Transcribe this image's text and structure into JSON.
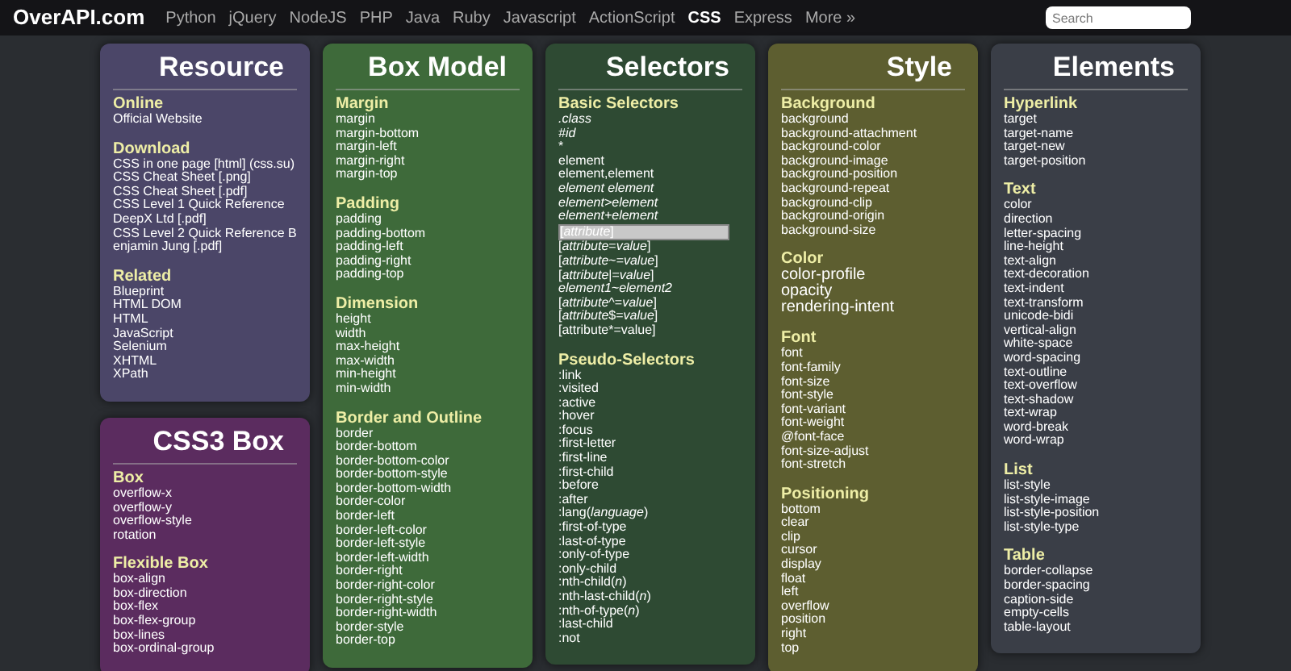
{
  "nav": {
    "logo": "OverAPI.com",
    "links": [
      {
        "label": "Python",
        "selected": false
      },
      {
        "label": "jQuery",
        "selected": false
      },
      {
        "label": "NodeJS",
        "selected": false
      },
      {
        "label": "PHP",
        "selected": false
      },
      {
        "label": "Java",
        "selected": false
      },
      {
        "label": "Ruby",
        "selected": false
      },
      {
        "label": "Javascript",
        "selected": false
      },
      {
        "label": "ActionScript",
        "selected": false
      },
      {
        "label": "CSS",
        "selected": true
      },
      {
        "label": "Express",
        "selected": false
      },
      {
        "label": "More »",
        "selected": false
      }
    ],
    "search": {
      "placeholder": "Search"
    }
  },
  "columns": [
    {
      "cards": [
        {
          "title": "Resource",
          "color": "#4b4668",
          "sections": [
            {
              "heading": "Online",
              "items": [
                "Official Website"
              ]
            },
            {
              "heading": "Download",
              "items": [
                "CSS in one page [html] (css.su)",
                "CSS Cheat Sheet [.png]",
                "CSS Cheat Sheet [.pdf]",
                "CSS Level 1 Quick Reference DeepX Ltd [.pdf]",
                "CSS Level 2 Quick Reference Benjamin Jung [.pdf]"
              ]
            },
            {
              "heading": "Related",
              "items": [
                "Blueprint",
                "HTML DOM",
                "HTML",
                "JavaScript",
                "Selenium",
                "XHTML",
                "XPath"
              ]
            }
          ]
        },
        {
          "title": "CSS3 Box",
          "color": "#5b2c5f",
          "sections": [
            {
              "heading": "Box",
              "items": [
                "overflow-x",
                "overflow-y",
                "overflow-style",
                "rotation"
              ]
            },
            {
              "heading": "Flexible Box",
              "items": [
                "box-align",
                "box-direction",
                "box-flex",
                "box-flex-group",
                "box-lines",
                "box-ordinal-group"
              ]
            }
          ]
        }
      ]
    },
    {
      "cards": [
        {
          "title": "Box Model",
          "color": "#3e6a3a",
          "sections": [
            {
              "heading": "Margin",
              "items": [
                "margin",
                "margin-bottom",
                "margin-left",
                "margin-right",
                "margin-top"
              ]
            },
            {
              "heading": "Padding",
              "items": [
                "padding",
                "padding-bottom",
                "padding-left",
                "padding-right",
                "padding-top"
              ]
            },
            {
              "heading": "Dimension",
              "items": [
                "height",
                "width",
                "max-height",
                "max-width",
                "min-height",
                "min-width"
              ]
            },
            {
              "heading": "Border and Outline",
              "items": [
                "border",
                "border-bottom",
                "border-bottom-color",
                "border-bottom-style",
                "border-bottom-width",
                "border-color",
                "border-left",
                "border-left-color",
                "border-left-style",
                "border-left-width",
                "border-right",
                "border-right-color",
                "border-right-style",
                "border-right-width",
                "border-style",
                "border-top"
              ]
            }
          ]
        }
      ]
    },
    {
      "cards": [
        {
          "title": "Selectors",
          "color": "#2e4a33",
          "sections": [
            {
              "heading": "Basic Selectors",
              "items": [
                {
                  "text": ".class",
                  "italic": true,
                  "highlighted": false
                },
                {
                  "text": "#id",
                  "italic": true,
                  "highlighted": false
                },
                {
                  "text": "*",
                  "italic": false,
                  "highlighted": false
                },
                {
                  "text": "element",
                  "italic": false,
                  "highlighted": false
                },
                {
                  "text": "element,element",
                  "italic": false,
                  "highlighted": false
                },
                {
                  "text": "element element",
                  "italic": true,
                  "highlighted": false
                },
                {
                  "text": "element>element",
                  "italic": true,
                  "highlighted": false
                },
                {
                  "text": "element+element",
                  "italic": true,
                  "highlighted": false
                },
                {
                  "text": "[*attribute*]",
                  "italic": false,
                  "highlighted": true
                },
                {
                  "text": "[*attribute*=*value*]",
                  "italic": false,
                  "highlighted": false
                },
                {
                  "text": "[*attribute*~=*value*]",
                  "italic": false,
                  "highlighted": false
                },
                {
                  "text": "[*attribute*|=*value*]",
                  "italic": false,
                  "highlighted": false
                },
                {
                  "text": "element1~element2",
                  "italic": true,
                  "highlighted": false
                },
                {
                  "text": "[*attribute*^=*value*]",
                  "italic": false,
                  "highlighted": false
                },
                {
                  "text": "[*attribute*$=*value*]",
                  "italic": false,
                  "highlighted": false
                },
                {
                  "text": "[attribute*=value]",
                  "italic": false,
                  "highlighted": false
                }
              ]
            },
            {
              "heading": "Pseudo-Selectors",
              "items": [
                ":link",
                ":visited",
                ":active",
                ":hover",
                ":focus",
                ":first-letter",
                ":first-line",
                ":first-child",
                ":before",
                ":after",
                ":lang(*language*)",
                ":first-of-type",
                ":last-of-type",
                ":only-of-type",
                ":only-child",
                ":nth-child(*n*)",
                ":nth-last-child(*n*)",
                ":nth-of-type(*n*)",
                ":last-child",
                ":not"
              ]
            }
          ]
        }
      ]
    },
    {
      "cards": [
        {
          "title": "Style",
          "color": "#5d5e30",
          "sections": [
            {
              "heading": "Background",
              "items": [
                "background",
                "background-attachment",
                "background-color",
                "background-image",
                "background-position",
                "background-repeat",
                "background-clip",
                "background-origin",
                "background-size"
              ]
            },
            {
              "heading": "Color",
              "large": true,
              "items": [
                "color-profile",
                "opacity",
                "rendering-intent"
              ]
            },
            {
              "heading": "Font",
              "items": [
                "font",
                "font-family",
                "font-size",
                "font-style",
                "font-variant",
                "font-weight",
                "@font-face",
                "font-size-adjust",
                "font-stretch"
              ]
            },
            {
              "heading": "Positioning",
              "items": [
                "bottom",
                "clear",
                "clip",
                "cursor",
                "display",
                "float",
                "left",
                "overflow",
                "position",
                "right",
                "top"
              ]
            }
          ]
        }
      ]
    },
    {
      "cards": [
        {
          "title": "Elements",
          "color": "#3a3e47",
          "sections": [
            {
              "heading": "Hyperlink",
              "items": [
                "target",
                "target-name",
                "target-new",
                "target-position"
              ]
            },
            {
              "heading": "Text",
              "items": [
                "color",
                "direction",
                "letter-spacing",
                "line-height",
                "text-align",
                "text-decoration",
                "text-indent",
                "text-transform",
                "unicode-bidi",
                "vertical-align",
                "white-space",
                "word-spacing",
                "text-outline",
                "text-overflow",
                "text-shadow",
                "text-wrap",
                "word-break",
                "word-wrap"
              ]
            },
            {
              "heading": "List",
              "items": [
                "list-style",
                "list-style-image",
                "list-style-position",
                "list-style-type"
              ]
            },
            {
              "heading": "Table",
              "items": [
                "border-collapse",
                "border-spacing",
                "caption-side",
                "empty-cells",
                "table-layout"
              ]
            }
          ]
        }
      ]
    }
  ]
}
